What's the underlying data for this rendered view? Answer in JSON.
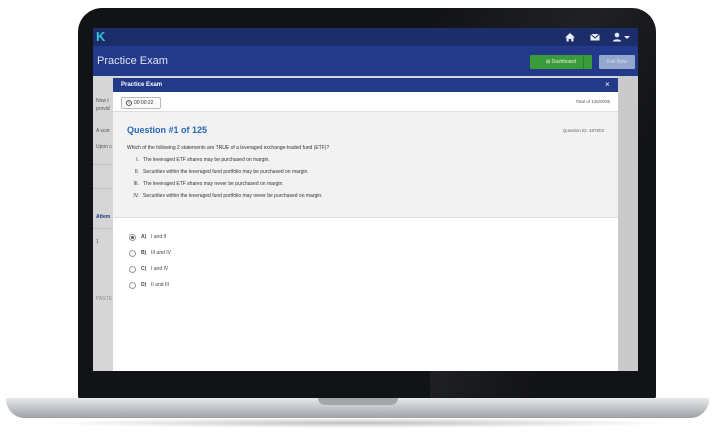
{
  "colors": {
    "topbar": "#1b2d6a",
    "pagebar": "#23398a",
    "accent_green": "#3a9b3a",
    "question_blue": "#2a66b7",
    "logo": "#35c4d8"
  },
  "app": {
    "logo": "K",
    "page_title": "Practice Exam",
    "nav_icons": [
      "home-icon",
      "mail-icon",
      "user-icon",
      "caret-down-icon"
    ]
  },
  "header_buttons": {
    "dashboard": "⊞ Dashboard",
    "exit": "Exit Now"
  },
  "background_page": {
    "snippets": [
      "Now t",
      "provid",
      "A scor",
      "Upon c",
      "Attem",
      "1",
      "PASTE"
    ]
  },
  "modal": {
    "title": "Practice Exam",
    "close": "×",
    "timer": "00:00:22",
    "total": "Total of 125/0035",
    "question_number": "Question #1 of 125",
    "question_id": "Question ID: 487803",
    "stem": "Which of the following 2 statements are TRUE of a leveraged exchange-traded fund (ETF)?",
    "statements": [
      {
        "numeral": "I.",
        "text": "The leveraged ETF shares may be purchased on margin."
      },
      {
        "numeral": "II.",
        "text": "Securities within the leveraged fund portfolio may be purchased on margin."
      },
      {
        "numeral": "III.",
        "text": "The leveraged ETF shares may never be purchased on margin."
      },
      {
        "numeral": "IV.",
        "text": "Securities within the leveraged fund portfolio may never be purchased on margin."
      }
    ],
    "answers": [
      {
        "letter": "A)",
        "text": "I and II",
        "selected": true
      },
      {
        "letter": "B)",
        "text": "III and IV",
        "selected": false
      },
      {
        "letter": "C)",
        "text": "I and IV",
        "selected": false
      },
      {
        "letter": "D)",
        "text": "II and III",
        "selected": false
      }
    ]
  }
}
